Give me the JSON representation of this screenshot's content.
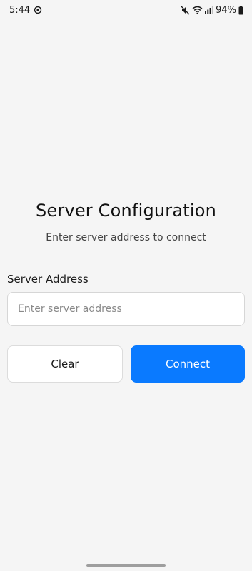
{
  "status_bar": {
    "time": "5:44",
    "battery_percent": "94%",
    "icons": [
      "settings-sync-icon",
      "mute-icon",
      "wifi-icon",
      "signal-icon",
      "battery-icon"
    ]
  },
  "screen": {
    "title": "Server Configuration",
    "subtitle": "Enter server address to connect"
  },
  "form": {
    "address_label": "Server Address",
    "address_value": "",
    "address_placeholder": "Enter server address"
  },
  "actions": {
    "clear_label": "Clear",
    "connect_label": "Connect"
  },
  "colors": {
    "background": "#f5f5f5",
    "primary": "#0a7aff",
    "input_border": "#d6d6d6"
  }
}
